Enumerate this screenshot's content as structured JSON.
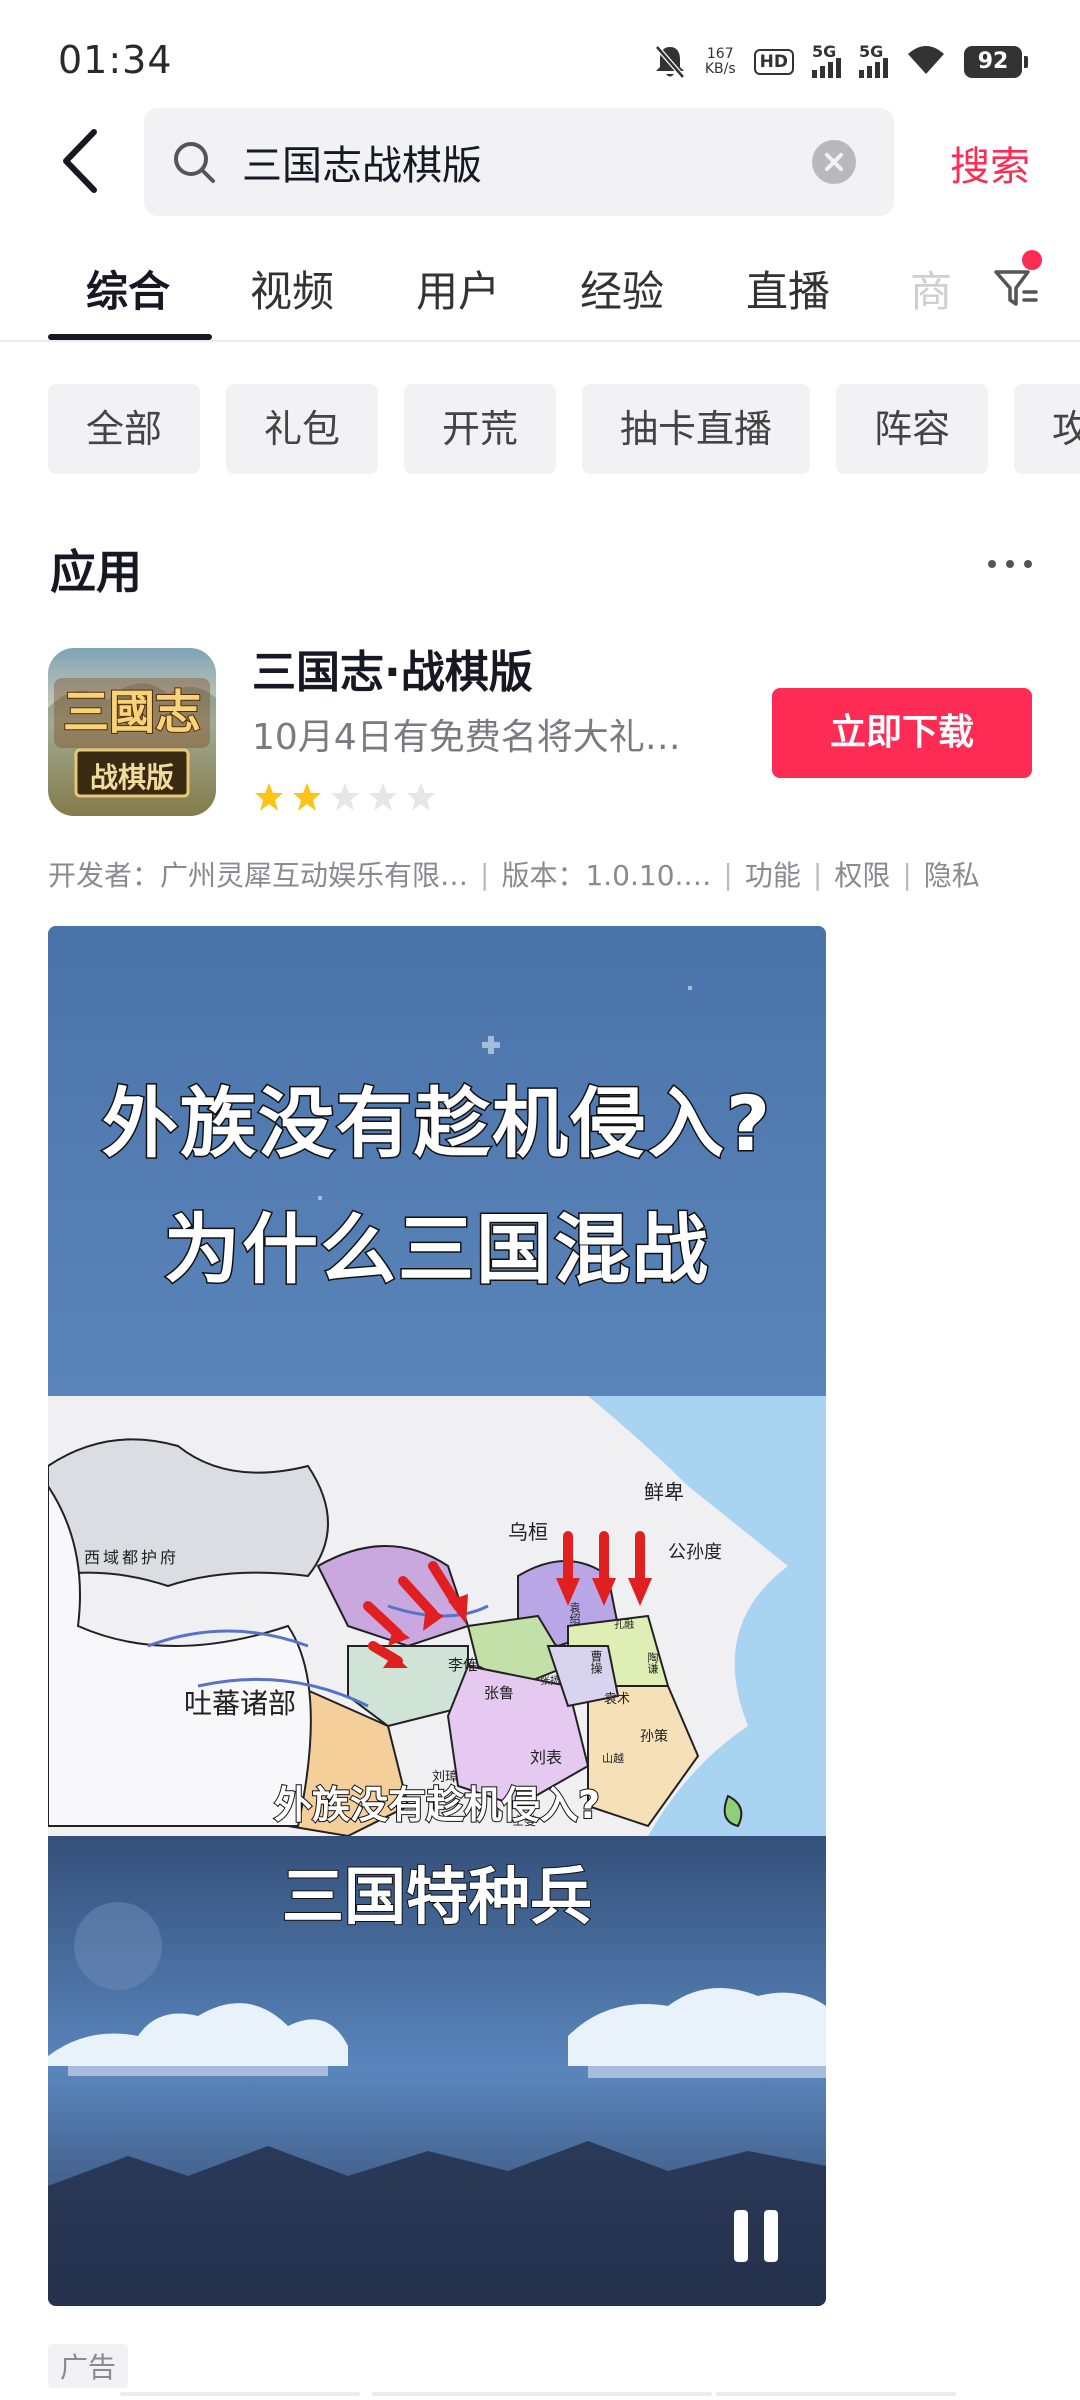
{
  "status_bar": {
    "time": "01:34",
    "net_speed_value": "167",
    "net_speed_unit": "KB/s",
    "hd_label": "HD",
    "sim1": "5G",
    "sim2": "5G",
    "battery": "92"
  },
  "search": {
    "query": "三国志战棋版",
    "submit_label": "搜索"
  },
  "tabs": [
    {
      "label": "综合",
      "active": true
    },
    {
      "label": "视频"
    },
    {
      "label": "用户"
    },
    {
      "label": "经验"
    },
    {
      "label": "直播"
    },
    {
      "label": "商"
    }
  ],
  "filter_chips": [
    "全部",
    "礼包",
    "开荒",
    "抽卡直播",
    "阵容",
    "攻"
  ],
  "section": {
    "title": "应用"
  },
  "app": {
    "name": "三国志·战棋版",
    "description": "10月4日有免费名将大礼…",
    "rating": 2,
    "rating_max": 5,
    "download_label": "立即下载",
    "icon_text_top": "三國志",
    "icon_text_bottom": "战棋版",
    "developer": "开发者：广州灵犀互动娱乐有限…",
    "version": "版本：1.0.10.…",
    "links": [
      "功能",
      "权限",
      "隐私"
    ]
  },
  "video": {
    "headline_1": "外族没有趁机侵入?",
    "headline_2": "为什么三国混战",
    "map_labels": {
      "xiyu": "西域都护府",
      "tubo": "吐蕃诸部",
      "wuhuan": "乌桓",
      "xianbei": "鲜卑",
      "gongsundu": "公孙度",
      "likui": "李傕",
      "zhanglu": "张鲁",
      "liubiao": "刘表",
      "sunce": "孙策",
      "caocao": "曹操",
      "yuanshu": "袁术",
      "liuzhang": "刘璋",
      "yuanshao": "袁绍",
      "kongrong": "孔融",
      "taoqian": "陶谦",
      "zhangyang": "张扬",
      "shanyue": "山越",
      "shixie": "士燮"
    },
    "subtitle": "外族没有趁机侵入?",
    "caption": "三国特种兵"
  },
  "ad_label": "广告",
  "colors": {
    "accent": "#fe2c55",
    "star_on": "#fcc419",
    "star_off": "#e6e6e8",
    "video_sky": "#4e78ad"
  }
}
